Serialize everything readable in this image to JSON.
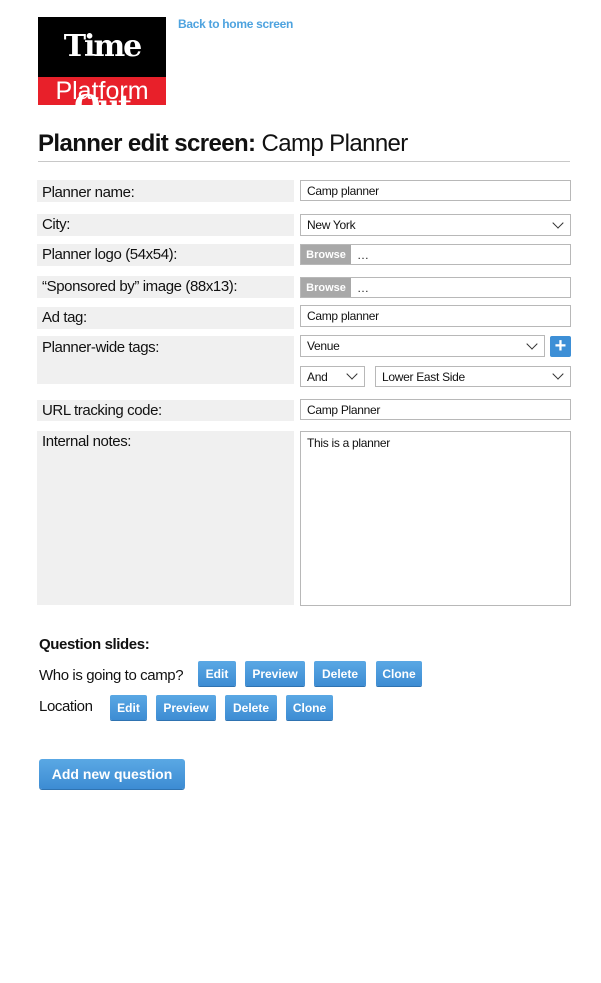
{
  "logo": {
    "line1": "Time Out",
    "line2": "Platform"
  },
  "nav": {
    "back_link": "Back to home screen"
  },
  "header": {
    "title_bold": "Planner edit screen:",
    "title_rest": " Camp Planner"
  },
  "form": {
    "planner_name": {
      "label": "Planner name:",
      "value": "Camp planner"
    },
    "city": {
      "label": "City:",
      "value": "New York"
    },
    "planner_logo": {
      "label": "Planner logo (54x54):",
      "button": "Browse",
      "value": "…"
    },
    "sponsored_image": {
      "label": "“Sponsored by” image (88x13):",
      "button": "Browse",
      "value": "…"
    },
    "ad_tag": {
      "label": "Ad tag:",
      "value": "Camp planner"
    },
    "planner_tags": {
      "label": "Planner-wide tags:",
      "tag_value": "Venue",
      "operator": "And",
      "location": "Lower East Side",
      "add_symbol": "+"
    },
    "url_tracking": {
      "label": "URL tracking code:",
      "value": "Camp Planner"
    },
    "notes": {
      "label": "Internal notes:",
      "value": "This is a planner"
    }
  },
  "questions": {
    "title": "Question slides:",
    "items": [
      {
        "label": "Who is going to camp?",
        "edit": "Edit",
        "preview": "Preview",
        "delete": "Delete",
        "clone": "Clone"
      },
      {
        "label": "Location",
        "edit": "Edit",
        "preview": "Preview",
        "delete": "Delete",
        "clone": "Clone"
      }
    ],
    "add_button": "Add new question"
  },
  "colors": {
    "accent": "#3d8cd3",
    "brand_red": "#e8202a",
    "link": "#4ea3df"
  }
}
